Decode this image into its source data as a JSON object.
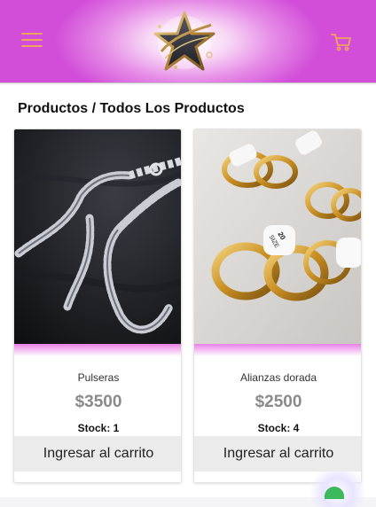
{
  "header": {
    "menu_icon": "hamburger-menu-icon",
    "logo_icon": "star-logo-icon",
    "cart_icon": "shopping-cart-icon",
    "accent_color": "#f0a35c"
  },
  "page": {
    "breadcrumb": "Productos / Todos Los Productos"
  },
  "products": [
    {
      "name": "Pulseras",
      "price": "$3500",
      "stock": "Stock: 1",
      "button": "Ingresar al carrito"
    },
    {
      "name": "Alianzas dorada",
      "price": "$2500",
      "stock": "Stock: 4",
      "button": "Ingresar al carrito"
    }
  ],
  "widgets": {
    "chat_icon": "chat-widget-icon"
  }
}
